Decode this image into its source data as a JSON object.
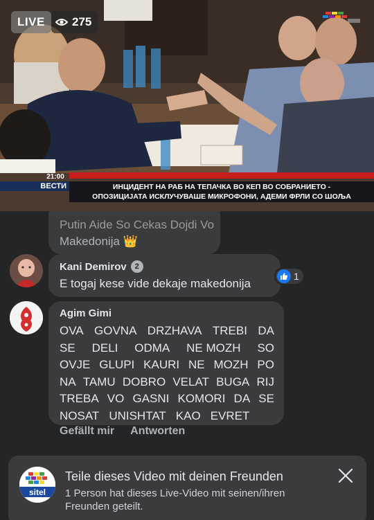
{
  "video": {
    "live_label": "LIVE",
    "viewer_count": "275",
    "ticker_time": "21:00",
    "ticker_show": "ВЕСТИ",
    "headline_line1": "ИНЦИДЕНТ НА РАБ НА ТЕПАЧКА ВО КЕП ВО СОБРАНИЕТО -",
    "headline_line2": "ОПОЗИЦИЈАТА ИСКЛУЧУВАШЕ МИКРОФОНИ, АДЕМИ ФРЛИ СО ШОЉА"
  },
  "previous_comment": {
    "line1": "Putin Aide So Cekas Dojdi Vo",
    "line2": "Makedonija 👑"
  },
  "comments": [
    {
      "author": "Kani Demirov",
      "badge": "2",
      "text": "E togaj kese vide dekaje makedonija",
      "reaction_count": "1"
    },
    {
      "author": "Agim Gimi",
      "lines": [
        [
          "OVA",
          "GOVNA",
          "DRZHAVA",
          "TREBI",
          "DA"
        ],
        [
          "SE",
          "DELI",
          "ODMA",
          "NE MOZH",
          "SO"
        ],
        [
          "OVJE",
          "GLUPI",
          "KAURI",
          "NE",
          "MOZH",
          "PO"
        ],
        [
          "NA",
          "TAMU",
          "DOBRO",
          "VELAT",
          "BUGA",
          "RIJ"
        ],
        [
          "TREBA",
          "VO",
          "GASNI",
          "KOMORI",
          "DA",
          "SE"
        ],
        [
          "NOSAT",
          "UNISHTAT",
          "KAO",
          "EVRET"
        ]
      ]
    }
  ],
  "actions": {
    "like": "Gefällt mir",
    "reply": "Antworten"
  },
  "share_banner": {
    "logo_text": "sitel",
    "title": "Teile dieses Video mit deinen Freunden",
    "description": "1 Person hat dieses Live-Video mit seinen/ihren Freunden geteilt."
  }
}
